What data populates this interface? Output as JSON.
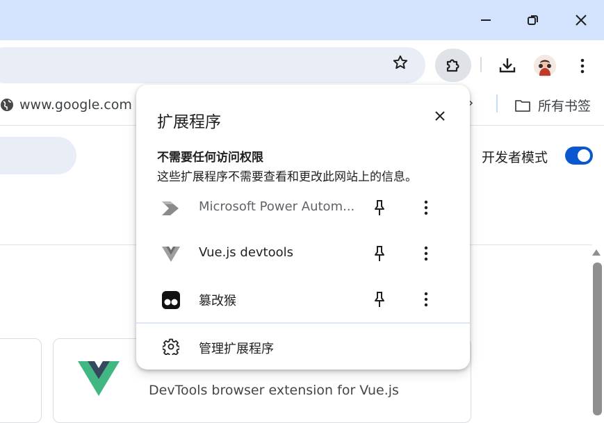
{
  "bookmarks": {
    "google_label": "www.google.com",
    "more_label": "»",
    "all_label": "所有书签"
  },
  "page": {
    "developer_mode_label": "开发者模式",
    "developer_mode_on": true,
    "card_desc": "DevTools browser extension for Vue.js"
  },
  "popup": {
    "title": "扩展程序",
    "section_title": "不需要任何访问权限",
    "section_desc": "这些扩展程序不需要查看和更改此网站上的信息。",
    "extensions": [
      {
        "name": "Microsoft Power Autom...",
        "icon": "power-automate-icon"
      },
      {
        "name": "Vue.js devtools",
        "icon": "vue-devtools-icon"
      },
      {
        "name": "篡改猴",
        "icon": "tampermonkey-icon"
      }
    ],
    "manage_label": "管理扩展程序"
  },
  "colors": {
    "titlebar": "#d3e3fd",
    "omnibox": "#e9eef6",
    "accent": "#0b57d0",
    "vue_green": "#41b883",
    "vue_dark": "#35495e"
  }
}
